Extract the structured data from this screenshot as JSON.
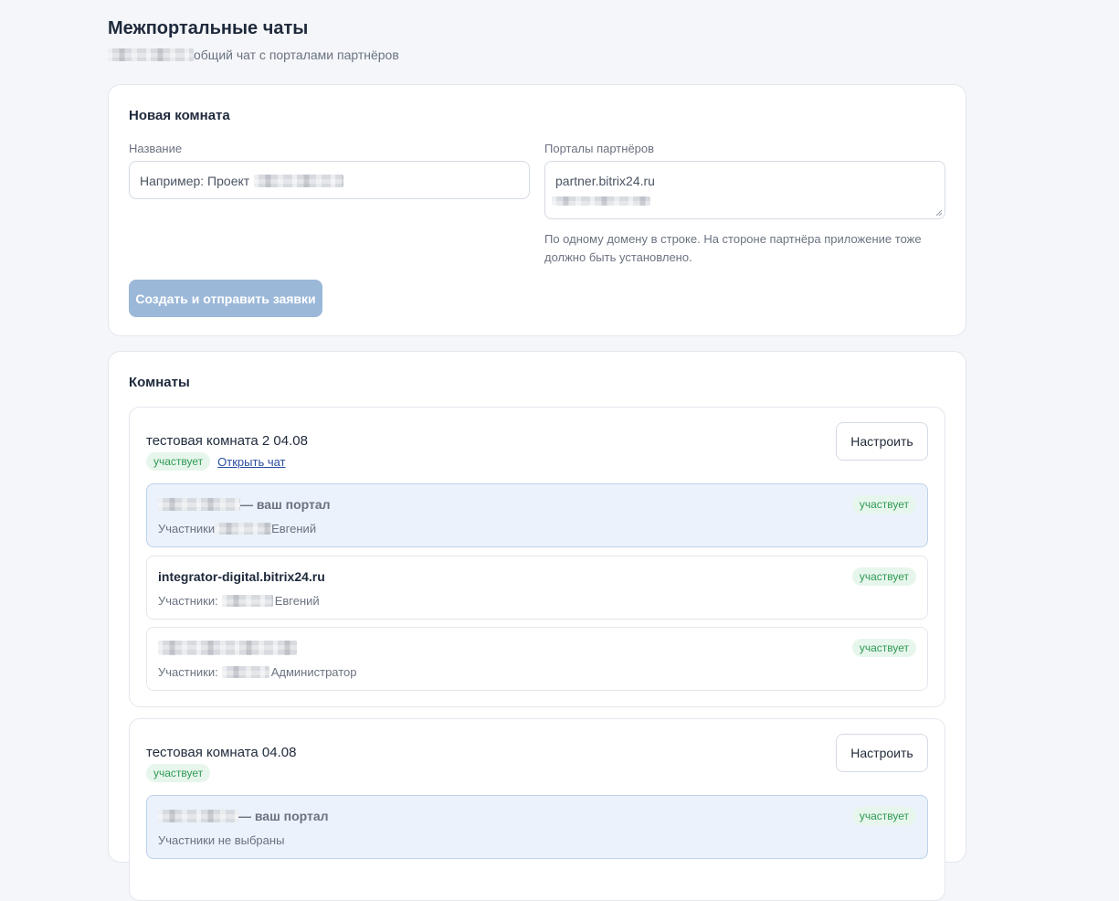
{
  "page": {
    "title": "Межпортальные чаты",
    "subtitle": "общий чат с порталами партнёров"
  },
  "new_room": {
    "title": "Новая комната",
    "name_label": "Название",
    "name_placeholder": "Например: Проект",
    "portals_label": "Порталы партнёров",
    "portals_value": "partner.bitrix24.ru",
    "hint": "По одному домену в строке. На стороне партнёра приложение тоже должно быть установлено.",
    "submit_label": "Создать и отправить заявки"
  },
  "rooms_section": {
    "title": "Комнаты",
    "configure_label": "Настроить",
    "open_chat_label": "Открыть чат",
    "own_portal_suffix": "— ваш портал",
    "rooms": [
      {
        "name": "тестовая комната 2 04.08",
        "status": "участвует",
        "portals": [
          {
            "domain": "",
            "own": true,
            "members_label": "Участники",
            "members": "Евгений",
            "status": "участвует"
          },
          {
            "domain": "integrator-digital.bitrix24.ru",
            "own": false,
            "members_label": "Участники:",
            "members": "Евгений",
            "status": "участвует"
          },
          {
            "domain": "",
            "own": false,
            "members_label": "Участники:",
            "members": "Администратор",
            "status": "участвует"
          }
        ]
      },
      {
        "name": "тестовая комната 04.08",
        "status": "участвует",
        "portals": [
          {
            "domain": "",
            "own": true,
            "members_label": "Участники не выбраны",
            "members": "",
            "status": "участвует"
          }
        ]
      }
    ]
  },
  "colors": {
    "background": "#f4f6f9",
    "primary_button": "#9bb8d9",
    "badge_bg": "#e7f6ec",
    "badge_text": "#2f9a55",
    "own_portal_bg": "#ebf2fb",
    "link": "#2b4ea0"
  }
}
